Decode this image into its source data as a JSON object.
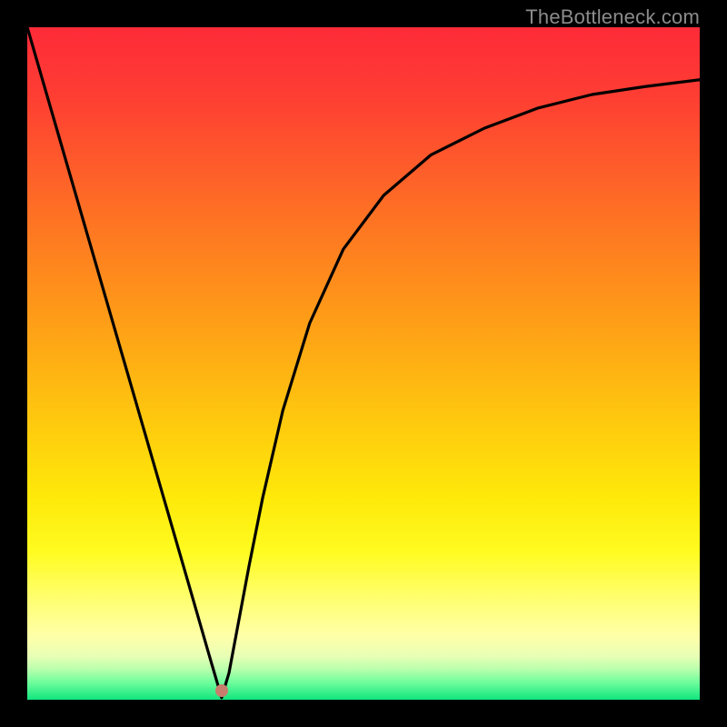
{
  "watermark": "TheBottleneck.com",
  "colors": {
    "dot": "#c77e6c",
    "curve": "#000000",
    "gradient_stops": [
      {
        "offset": 0.0,
        "color": "#fe2b38"
      },
      {
        "offset": 0.1,
        "color": "#fe3d33"
      },
      {
        "offset": 0.2,
        "color": "#fe5a2b"
      },
      {
        "offset": 0.3,
        "color": "#fe7722"
      },
      {
        "offset": 0.4,
        "color": "#fe931a"
      },
      {
        "offset": 0.5,
        "color": "#feb013"
      },
      {
        "offset": 0.6,
        "color": "#fecd0d"
      },
      {
        "offset": 0.7,
        "color": "#fee90a"
      },
      {
        "offset": 0.78,
        "color": "#fffb20"
      },
      {
        "offset": 0.85,
        "color": "#ffff70"
      },
      {
        "offset": 0.905,
        "color": "#ffffa8"
      },
      {
        "offset": 0.935,
        "color": "#e8ffb5"
      },
      {
        "offset": 0.955,
        "color": "#b8ffac"
      },
      {
        "offset": 0.975,
        "color": "#6cfd9b"
      },
      {
        "offset": 1.0,
        "color": "#11e57e"
      }
    ]
  },
  "chart_data": {
    "type": "line",
    "title": "",
    "xlabel": "",
    "ylabel": "",
    "xlim": [
      0,
      1
    ],
    "ylim": [
      0,
      1
    ],
    "legend": false,
    "grid": false,
    "marker": {
      "x": 0.289,
      "y": 0.014
    },
    "series": [
      {
        "name": "curve",
        "x": [
          0.0,
          0.04,
          0.08,
          0.12,
          0.16,
          0.2,
          0.24,
          0.27,
          0.289,
          0.3,
          0.315,
          0.33,
          0.35,
          0.38,
          0.42,
          0.47,
          0.53,
          0.6,
          0.68,
          0.76,
          0.84,
          0.92,
          1.0
        ],
        "y": [
          1.0,
          0.862,
          0.724,
          0.586,
          0.448,
          0.31,
          0.172,
          0.068,
          0.003,
          0.04,
          0.12,
          0.2,
          0.3,
          0.43,
          0.56,
          0.67,
          0.75,
          0.81,
          0.85,
          0.88,
          0.9,
          0.912,
          0.922
        ]
      }
    ]
  }
}
